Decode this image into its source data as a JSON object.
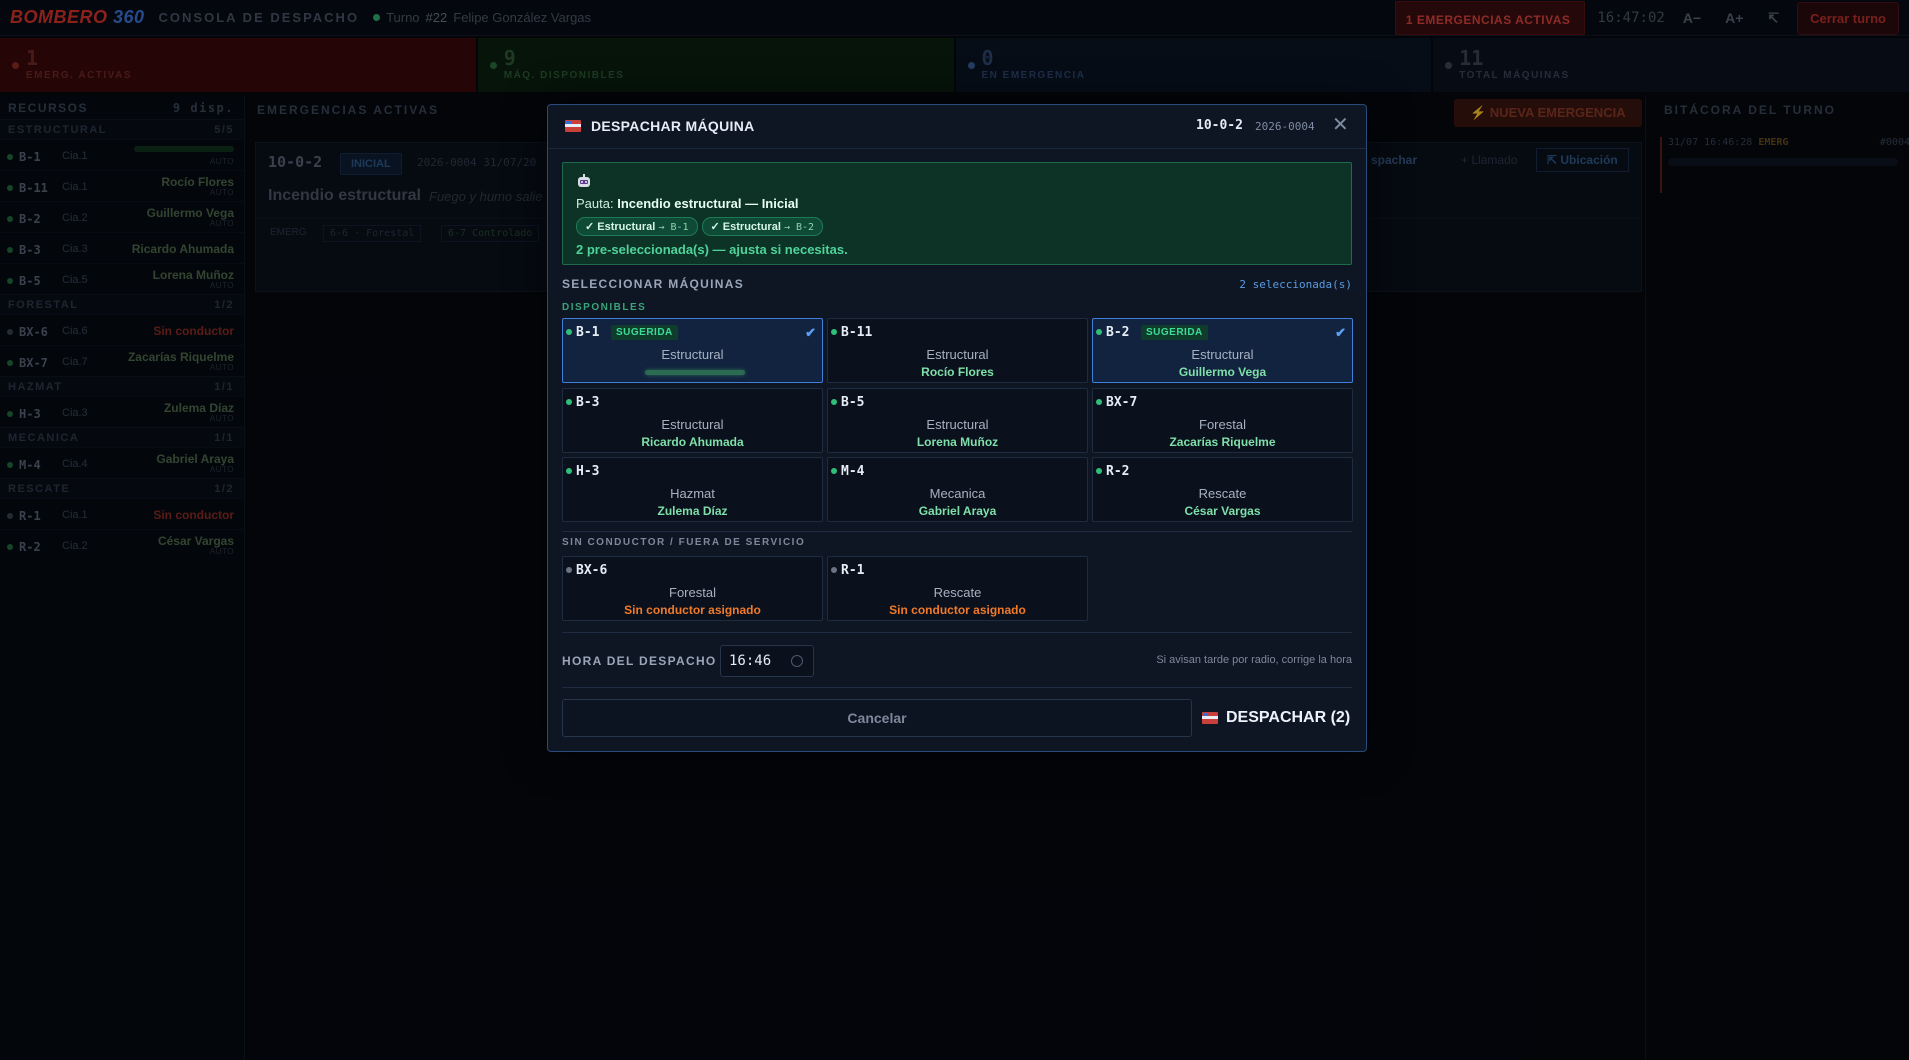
{
  "topbar": {
    "brand_a": "BOMBERO",
    "brand_b": " 360",
    "console_label": "CONSOLA DE DESPACHO",
    "turno_prefix": "Turno",
    "turno_num": "#22",
    "turno_user": "Felipe González Vargas",
    "alert": "1 EMERGENCIAS ACTIVAS",
    "clock": "16:47:02",
    "font_minus": "A−",
    "font_plus": "A+",
    "expand_icon": "↸",
    "close_shift": "Cerrar turno"
  },
  "stats": [
    {
      "value": "1",
      "label": "EMERG. ACTIVAS"
    },
    {
      "value": "9",
      "label": "MÁQ. DISPONIBLES"
    },
    {
      "value": "0",
      "label": "EN EMERGENCIA"
    },
    {
      "value": "11",
      "label": "TOTAL MÁQUINAS"
    }
  ],
  "sidebar": {
    "title": "RECURSOS",
    "count": "9 disp.",
    "groups": {
      "estructural": {
        "name": "ESTRUCTURAL",
        "count": "5/5"
      },
      "forestal": {
        "name": "FORESTAL",
        "count": "1/2"
      },
      "hazmat": {
        "name": "HAZMAT",
        "count": "1/1"
      },
      "mecanica": {
        "name": "MECANICA",
        "count": "1/1"
      },
      "rescate": {
        "name": "RESCATE",
        "count": "1/2"
      }
    },
    "items": [
      {
        "code": "B-1",
        "cia": "Cia.1",
        "driver": "",
        "auto": "AUTO"
      },
      {
        "code": "B-11",
        "cia": "Cia.1",
        "driver": "Rocío Flores",
        "auto": "AUTO"
      },
      {
        "code": "B-2",
        "cia": "Cia.2",
        "driver": "Guillermo Vega",
        "auto": "AUTO"
      },
      {
        "code": "B-3",
        "cia": "Cia.3",
        "driver": "Ricardo Ahumada",
        "auto": ""
      },
      {
        "code": "B-5",
        "cia": "Cia.5",
        "driver": "Lorena Muñoz",
        "auto": "AUTO"
      },
      {
        "code": "BX-6",
        "cia": "Cia.6",
        "driver": "Sin conductor",
        "auto": ""
      },
      {
        "code": "BX-7",
        "cia": "Cia.7",
        "driver": "Zacarías Riquelme",
        "auto": "AUTO"
      },
      {
        "code": "H-3",
        "cia": "Cia.3",
        "driver": "Zulema Díaz",
        "auto": "AUTO"
      },
      {
        "code": "M-4",
        "cia": "Cia.4",
        "driver": "Gabriel Araya",
        "auto": "AUTO"
      },
      {
        "code": "R-1",
        "cia": "Cia.1",
        "driver": "Sin conductor",
        "auto": ""
      },
      {
        "code": "R-2",
        "cia": "Cia.2",
        "driver": "César Vargas",
        "auto": "AUTO"
      }
    ]
  },
  "center": {
    "heading": "EMERGENCIAS ACTIVAS",
    "new_button": "⚡ NUEVA EMERGENCIA",
    "card": {
      "code": "10-0-2",
      "badge": "INICIAL",
      "folio": "2026-0004  31/07/20",
      "title": "Incendio estructural",
      "subtitle": "Fuego y humo salie",
      "tag_lbl": "EMERG",
      "tag1": "6-6 · Forestal",
      "tag2": "6-7 Controlado",
      "dispatch": "spachar",
      "call": "+ Llamado",
      "location": "Ubicación"
    }
  },
  "bitacora": {
    "title": "BITÁCORA DEL TURNO",
    "date": "31/07",
    "time": "16:46:28",
    "type": "EMERG",
    "ref": "#0004"
  },
  "modal": {
    "title": "DESPACHAR MÁQUINA",
    "code": "10-0-2",
    "folio": "2026-0004",
    "pauta": {
      "prefix": "Pauta:",
      "text": "Incendio estructural — Inicial",
      "chips": [
        {
          "label": "✓ Estructural",
          "target": "→ B-1"
        },
        {
          "label": "✓ Estructural",
          "target": "→ B-2"
        }
      ],
      "note": "2 pre-seleccionada(s) — ajusta si necesitas."
    },
    "select_heading": "SELECCIONAR MÁQUINAS",
    "select_count": "2 seleccionada(s)",
    "available_heading": "DISPONIBLES",
    "available": [
      {
        "code": "B-1",
        "type": "Estructural",
        "driver": "",
        "suggested": "SUGERIDA",
        "selected": true
      },
      {
        "code": "B-11",
        "type": "Estructural",
        "driver": "Rocío Flores"
      },
      {
        "code": "B-2",
        "type": "Estructural",
        "driver": "Guillermo Vega",
        "suggested": "SUGERIDA",
        "selected": true
      },
      {
        "code": "B-3",
        "type": "Estructural",
        "driver": "Ricardo Ahumada"
      },
      {
        "code": "B-5",
        "type": "Estructural",
        "driver": "Lorena Muñoz"
      },
      {
        "code": "BX-7",
        "type": "Forestal",
        "driver": "Zacarías Riquelme"
      },
      {
        "code": "H-3",
        "type": "Hazmat",
        "driver": "Zulema Díaz"
      },
      {
        "code": "M-4",
        "type": "Mecanica",
        "driver": "Gabriel Araya"
      },
      {
        "code": "R-2",
        "type": "Rescate",
        "driver": "César Vargas"
      }
    ],
    "unavailable_heading": "SIN CONDUCTOR / FUERA DE SERVICIO",
    "unavailable": [
      {
        "code": "BX-6",
        "type": "Forestal",
        "driver": "Sin conductor asignado"
      },
      {
        "code": "R-1",
        "type": "Rescate",
        "driver": "Sin conductor asignado"
      }
    ],
    "time_label": "HORA DEL DESPACHO",
    "time_value": "16:46",
    "time_hint": "Si avisan tarde por radio, corrige la hora",
    "cancel": "Cancelar",
    "dispatch": "DESPACHAR (2)",
    "check_mark": "✔",
    "close_glyph": "✕"
  }
}
